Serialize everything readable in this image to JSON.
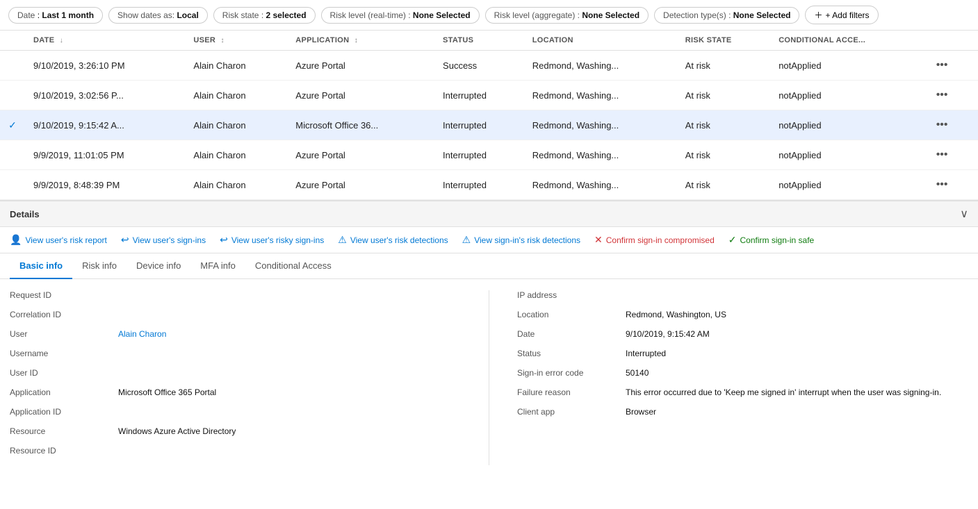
{
  "filters": {
    "date": {
      "label": "Date",
      "value": "Last 1 month"
    },
    "showDates": {
      "label": "Show dates as:",
      "value": "Local"
    },
    "riskState": {
      "label": "Risk state :",
      "value": "2 selected"
    },
    "riskLevelRealtime": {
      "label": "Risk level (real-time) :",
      "value": "None Selected"
    },
    "riskLevelAggregate": {
      "label": "Risk level (aggregate) :",
      "value": "None Selected"
    },
    "detectionTypes": {
      "label": "Detection type(s) :",
      "value": "None Selected"
    },
    "addFilters": "+ Add filters"
  },
  "table": {
    "columns": [
      "DATE",
      "USER",
      "APPLICATION",
      "STATUS",
      "LOCATION",
      "RISK STATE",
      "CONDITIONAL ACCE..."
    ],
    "rows": [
      {
        "date": "9/10/2019, 3:26:10 PM",
        "user": "Alain Charon",
        "application": "Azure Portal",
        "status": "Success",
        "location": "Redmond, Washing...",
        "riskState": "At risk",
        "conditionalAccess": "notApplied",
        "selected": false
      },
      {
        "date": "9/10/2019, 3:02:56 P...",
        "user": "Alain Charon",
        "application": "Azure Portal",
        "status": "Interrupted",
        "location": "Redmond, Washing...",
        "riskState": "At risk",
        "conditionalAccess": "notApplied",
        "selected": false
      },
      {
        "date": "9/10/2019, 9:15:42 A...",
        "user": "Alain Charon",
        "application": "Microsoft Office 36...",
        "status": "Interrupted",
        "location": "Redmond, Washing...",
        "riskState": "At risk",
        "conditionalAccess": "notApplied",
        "selected": true
      },
      {
        "date": "9/9/2019, 11:01:05 PM",
        "user": "Alain Charon",
        "application": "Azure Portal",
        "status": "Interrupted",
        "location": "Redmond, Washing...",
        "riskState": "At risk",
        "conditionalAccess": "notApplied",
        "selected": false
      },
      {
        "date": "9/9/2019, 8:48:39 PM",
        "user": "Alain Charon",
        "application": "Azure Portal",
        "status": "Interrupted",
        "location": "Redmond, Washing...",
        "riskState": "At risk",
        "conditionalAccess": "notApplied",
        "selected": false
      }
    ]
  },
  "details": {
    "header": "Details",
    "actions": [
      {
        "id": "view-risk-report",
        "label": "View user's risk report",
        "icon": "👤"
      },
      {
        "id": "view-sign-ins",
        "label": "View user's sign-ins",
        "icon": "↩"
      },
      {
        "id": "view-risky-sign-ins",
        "label": "View user's risky sign-ins",
        "icon": "↩"
      },
      {
        "id": "view-risk-detections",
        "label": "View user's risk detections",
        "icon": "⚠"
      },
      {
        "id": "view-sign-in-detections",
        "label": "View sign-in's risk detections",
        "icon": "⚠"
      },
      {
        "id": "confirm-compromised",
        "label": "Confirm sign-in compromised",
        "icon": "✕",
        "style": "danger"
      },
      {
        "id": "confirm-safe",
        "label": "Confirm sign-in safe",
        "icon": "✓",
        "style": "success"
      }
    ],
    "tabs": [
      {
        "id": "basic-info",
        "label": "Basic info",
        "active": true
      },
      {
        "id": "risk-info",
        "label": "Risk info",
        "active": false
      },
      {
        "id": "device-info",
        "label": "Device info",
        "active": false
      },
      {
        "id": "mfa-info",
        "label": "MFA info",
        "active": false
      },
      {
        "id": "conditional-access",
        "label": "Conditional Access",
        "active": false
      }
    ],
    "basicInfo": {
      "left": [
        {
          "label": "Request ID",
          "value": ""
        },
        {
          "label": "Correlation ID",
          "value": ""
        },
        {
          "label": "User",
          "value": "Alain Charon",
          "isLink": true
        },
        {
          "label": "Username",
          "value": ""
        },
        {
          "label": "User ID",
          "value": ""
        },
        {
          "label": "Application",
          "value": "Microsoft Office 365 Portal"
        },
        {
          "label": "Application ID",
          "value": ""
        },
        {
          "label": "Resource",
          "value": "Windows Azure Active Directory"
        },
        {
          "label": "Resource ID",
          "value": ""
        }
      ],
      "right": [
        {
          "label": "IP address",
          "value": ""
        },
        {
          "label": "Location",
          "value": "Redmond, Washington, US"
        },
        {
          "label": "Date",
          "value": "9/10/2019, 9:15:42 AM"
        },
        {
          "label": "Status",
          "value": "Interrupted"
        },
        {
          "label": "Sign-in error code",
          "value": "50140"
        },
        {
          "label": "Failure reason",
          "value": "This error occurred due to 'Keep me signed in' interrupt when the user was signing-in."
        },
        {
          "label": "Client app",
          "value": "Browser"
        }
      ]
    }
  }
}
